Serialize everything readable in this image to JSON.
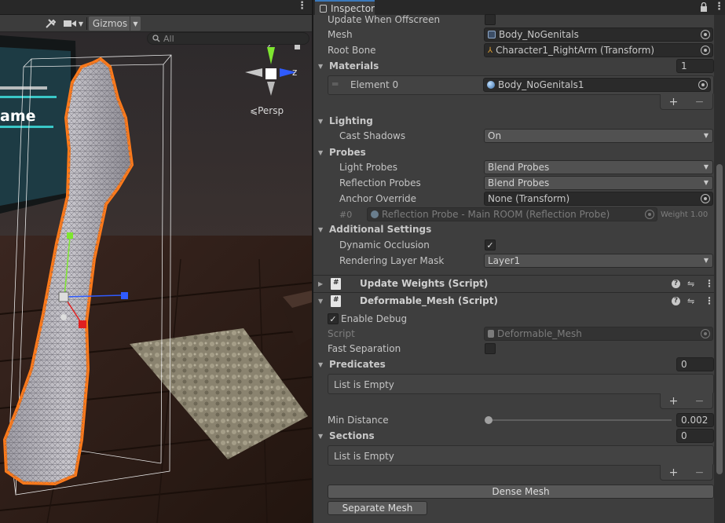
{
  "scene": {
    "toolbar": {
      "tools_icon": "tools-icon",
      "camera_icon": "camera-icon",
      "gizmos_label": "Gizmos",
      "search_placeholder": "All"
    },
    "persp_label": "Persp",
    "overlay_text": "ame",
    "axis_labels": {
      "y": "y",
      "z": "z"
    },
    "colors": {
      "outline": "#ff7a1a",
      "axis_y": "#7ee630",
      "axis_z": "#2f5bff",
      "axis_x": "#e02020"
    }
  },
  "inspector": {
    "tab_label": "Inspector",
    "fields": {
      "update_offscreen": {
        "label": "Update When Offscreen",
        "checked": false
      },
      "mesh": {
        "label": "Mesh",
        "value": "Body_NoGenitals"
      },
      "root_bone": {
        "label": "Root Bone",
        "value": "Character1_RightArm (Transform)"
      },
      "materials": {
        "label": "Materials",
        "count": "1",
        "element_label": "Element 0",
        "element_value": "Body_NoGenitals1"
      },
      "lighting": {
        "label": "Lighting",
        "cast_shadows_label": "Cast Shadows",
        "cast_shadows_value": "On"
      },
      "probes": {
        "label": "Probes",
        "light_probes_label": "Light Probes",
        "light_probes_value": "Blend Probes",
        "reflection_probes_label": "Reflection Probes",
        "reflection_probes_value": "Blend Probes",
        "anchor_override_label": "Anchor Override",
        "anchor_override_value": "None (Transform)",
        "probe_index": "#0",
        "probe_value": "Reflection Probe - Main ROOM (Reflection Probe)",
        "probe_weight": "Weight 1.00"
      },
      "additional": {
        "label": "Additional Settings",
        "dynamic_occlusion_label": "Dynamic Occlusion",
        "dynamic_occlusion_checked": true,
        "rendering_layer_label": "Rendering Layer Mask",
        "rendering_layer_value": "Layer1"
      }
    },
    "components": {
      "update_weights": {
        "title": "Update Weights (Script)"
      },
      "deformable_mesh": {
        "title": "Deformable_Mesh (Script)",
        "enable_debug_label": "Enable Debug",
        "enable_debug_checked": true,
        "script_label": "Script",
        "script_value": "Deformable_Mesh",
        "fast_separation_label": "Fast Separation",
        "fast_separation_checked": false,
        "predicates_label": "Predicates",
        "predicates_count": "0",
        "predicates_empty": "List is Empty",
        "min_distance_label": "Min Distance",
        "min_distance_value": "0.002",
        "min_distance_fraction": 0.0,
        "sections_label": "Sections",
        "sections_count": "0",
        "sections_empty": "List is Empty",
        "dense_mesh_button": "Dense Mesh",
        "separate_mesh_button": "Separate Mesh"
      }
    },
    "list_footer": {
      "add": "+",
      "remove": "−"
    },
    "colors": {
      "tab_accent": "#3a79bb",
      "panel_bg": "#3e3e3e"
    }
  }
}
